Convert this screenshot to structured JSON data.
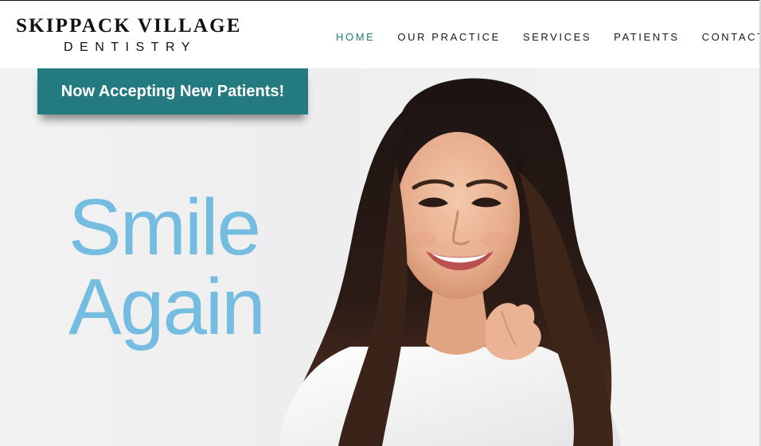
{
  "brand": {
    "name_top": "SKIPPACK VILLAGE",
    "name_bottom": "DENTISTRY"
  },
  "nav": {
    "items": [
      {
        "label": "HOME",
        "active": true
      },
      {
        "label": "OUR PRACTICE",
        "active": false
      },
      {
        "label": "SERVICES",
        "active": false
      },
      {
        "label": "PATIENTS",
        "active": false
      },
      {
        "label": "CONTACT U",
        "active": false
      }
    ]
  },
  "hero": {
    "cta_label": "Now Accepting New Patients!",
    "headline_line1": "Smile",
    "headline_line2": "Again",
    "image_subject": "smiling woman portrait"
  },
  "colors": {
    "accent": "#237a7f",
    "nav_active": "#1f7a80",
    "headline": "#74bde0"
  }
}
